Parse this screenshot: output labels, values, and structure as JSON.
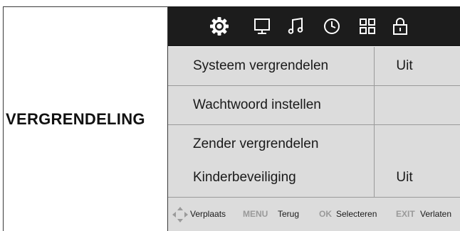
{
  "section_title": "VERGRENDELING",
  "tabs": [
    {
      "icon": "gear-icon",
      "active": true
    },
    {
      "icon": "monitor-icon",
      "active": false
    },
    {
      "icon": "music-note-icon",
      "active": false
    },
    {
      "icon": "clock-icon",
      "active": false
    },
    {
      "icon": "grid-apps-icon",
      "active": false
    },
    {
      "icon": "lock-icon",
      "active": false
    }
  ],
  "menu_items": [
    {
      "label": "Systeem vergrendelen",
      "value": "Uit"
    },
    {
      "label": "Wachtwoord instellen",
      "value": ""
    },
    {
      "label": "Zender vergrendelen",
      "value": ""
    },
    {
      "label": "Kinderbeveiliging",
      "value": "Uit"
    }
  ],
  "footer": {
    "move_label": "Verplaats",
    "menu_key": "MENU",
    "menu_label": "Terug",
    "ok_key": "OK",
    "ok_label": "Selecteren",
    "exit_key": "EXIT",
    "exit_label": "Verlaten"
  },
  "colors": {
    "tabbar_bg": "#1c1c1c",
    "row_bg": "#dcdcdc",
    "key_text": "#9a9a9a"
  }
}
